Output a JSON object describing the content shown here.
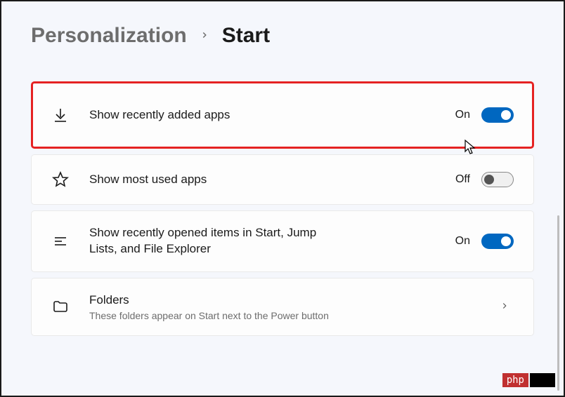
{
  "breadcrumb": {
    "parent": "Personalization",
    "current": "Start"
  },
  "settings": [
    {
      "title": "Show recently added apps",
      "subtitle": "",
      "state_label": "On",
      "toggle_on": true,
      "highlighted": true,
      "icon": "download"
    },
    {
      "title": "Show most used apps",
      "subtitle": "",
      "state_label": "Off",
      "toggle_on": false,
      "highlighted": false,
      "icon": "star"
    },
    {
      "title": "Show recently opened items in Start, Jump Lists, and File Explorer",
      "subtitle": "",
      "state_label": "On",
      "toggle_on": true,
      "highlighted": false,
      "icon": "list"
    },
    {
      "title": "Folders",
      "subtitle": "These folders appear on Start next to the Power button",
      "state_label": "",
      "toggle_on": null,
      "highlighted": false,
      "icon": "folder",
      "nav": true
    }
  ],
  "watermark": "php"
}
